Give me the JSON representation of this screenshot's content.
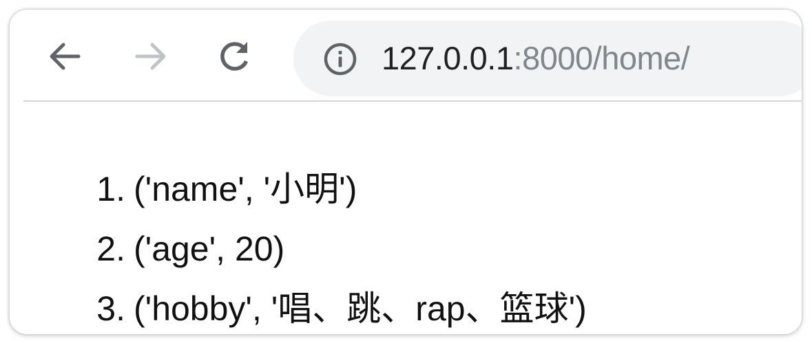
{
  "browser": {
    "toolbar": {
      "back_icon": "arrow-left-icon",
      "forward_icon": "arrow-right-icon",
      "reload_icon": "reload-icon",
      "forward_enabled": false
    },
    "address_bar": {
      "info_icon": "info-circle-icon",
      "url_host": "127.0.0.1",
      "url_rest": ":8000/home/",
      "colors": {
        "background": "#f1f3f4",
        "host_text": "#202124",
        "path_text": "#80868b"
      }
    }
  },
  "page": {
    "list": {
      "items": [
        {
          "marker": "1.",
          "text": "('name', '小明')"
        },
        {
          "marker": "2.",
          "text": "('age', 20)"
        },
        {
          "marker": "3.",
          "text": "('hobby', '唱、跳、rap、篮球')"
        }
      ]
    }
  }
}
